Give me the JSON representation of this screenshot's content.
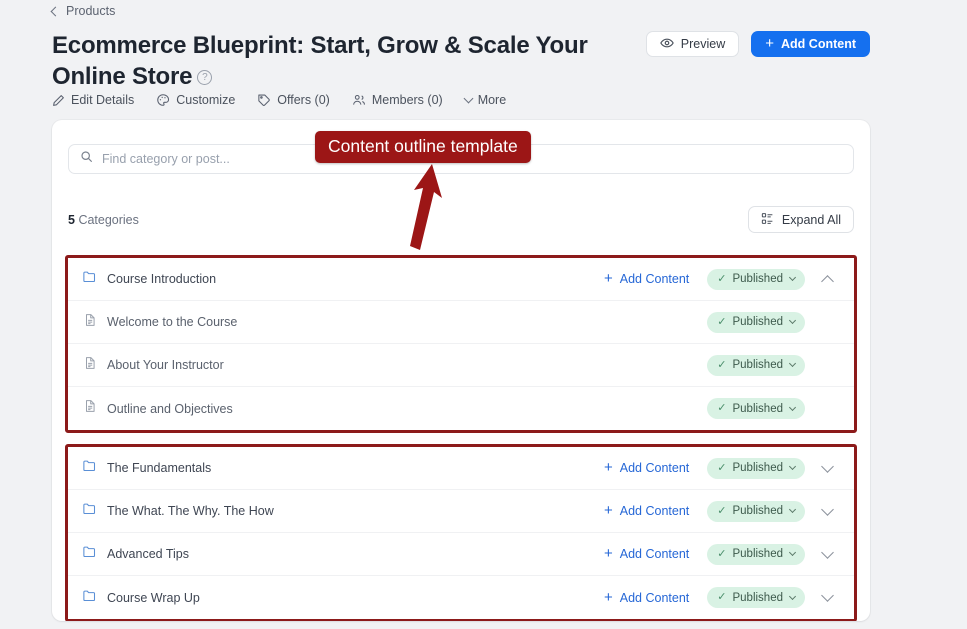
{
  "breadcrumb": {
    "label": "Products",
    "icon": "chevron-left-icon"
  },
  "header": {
    "title": "Ecommerce Blueprint: Start, Grow & Scale Your Online Store",
    "help_icon": "question-mark-circle-icon",
    "preview_button": "Preview",
    "preview_icon": "eye-icon",
    "add_content_button": "Add Content",
    "add_icon": "plus-icon"
  },
  "nav_tabs": [
    {
      "label": "Edit Details",
      "icon": "pencil-icon"
    },
    {
      "label": "Customize",
      "icon": "palette-icon"
    },
    {
      "label": "Offers (0)",
      "icon": "tag-icon"
    },
    {
      "label": "Members (0)",
      "icon": "users-icon"
    },
    {
      "label": "More",
      "icon": "chevron-down-icon"
    }
  ],
  "search": {
    "placeholder": "Find category or post...",
    "value": "",
    "icon": "search-icon"
  },
  "toolbar": {
    "count_number": "5",
    "count_label": "Categories",
    "expand_all_label": "Expand All",
    "expand_all_icon": "list-layout-icon"
  },
  "annotation": {
    "label": "Content outline template",
    "color": "#9c1616",
    "arrow": "up-arrow"
  },
  "labels": {
    "add_content": "Add Content",
    "published": "Published",
    "check_icon": "check-icon",
    "chevron_down_icon": "chevron-down-icon",
    "chevron_up_icon": "chevron-up-icon",
    "folder_icon": "folder-icon",
    "document_icon": "document-icon"
  },
  "groups": [
    {
      "rows": [
        {
          "type": "category",
          "title": "Course Introduction",
          "icon": "folder-icon",
          "add_content": "Add Content",
          "status": "Published",
          "toggle": "chevron-up-icon"
        },
        {
          "type": "lesson",
          "title": "Welcome to the Course",
          "icon": "document-icon",
          "status": "Published"
        },
        {
          "type": "lesson",
          "title": "About Your Instructor",
          "icon": "document-icon",
          "status": "Published"
        },
        {
          "type": "lesson",
          "title": "Outline and Objectives",
          "icon": "document-icon",
          "status": "Published"
        }
      ]
    },
    {
      "rows": [
        {
          "type": "category",
          "title": "The Fundamentals",
          "icon": "folder-icon",
          "add_content": "Add Content",
          "status": "Published",
          "toggle": "chevron-down-icon"
        },
        {
          "type": "category",
          "title": "The What. The Why. The How",
          "icon": "folder-icon",
          "add_content": "Add Content",
          "status": "Published",
          "toggle": "chevron-down-icon"
        },
        {
          "type": "category",
          "title": "Advanced Tips",
          "icon": "folder-icon",
          "add_content": "Add Content",
          "status": "Published",
          "toggle": "chevron-down-icon"
        },
        {
          "type": "category",
          "title": "Course Wrap Up",
          "icon": "folder-icon",
          "add_content": "Add Content",
          "status": "Published",
          "toggle": "chevron-down-icon"
        }
      ]
    }
  ],
  "colors": {
    "accent_blue": "#1570ef",
    "link_blue": "#2667d6",
    "badge_green_bg": "#d9f2e4",
    "annotation_red": "#9c1616",
    "page_bg": "#f1f2f4"
  }
}
